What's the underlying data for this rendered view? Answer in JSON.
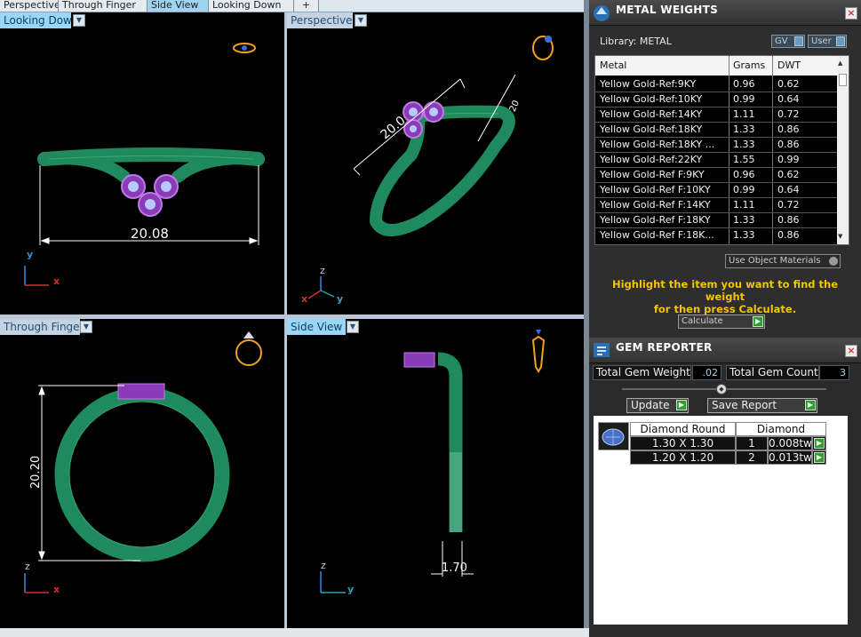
{
  "tabs": [
    {
      "label": "Perspective"
    },
    {
      "label": "Through Finger"
    },
    {
      "label": "Side View",
      "active": true
    },
    {
      "label": "Looking Down"
    },
    {
      "label": "+"
    }
  ],
  "viewports": {
    "top_left": {
      "label": "Looking Down",
      "dimension": "20.08",
      "axes": [
        "y",
        "x"
      ]
    },
    "top_right": {
      "label": "Perspective",
      "dimension_diag": "20.0",
      "dimension_side": "20",
      "axes": [
        "z",
        "x",
        "y"
      ]
    },
    "bottom_left": {
      "label": "Through Finger",
      "dimension": "20.20",
      "axes": [
        "z",
        "x"
      ]
    },
    "bottom_right": {
      "label": "Side View",
      "dimension": "1.70",
      "axes": [
        "z",
        "y"
      ]
    }
  },
  "metal_weights": {
    "title": "METAL WEIGHTS",
    "close": "×",
    "library_label": "Library: METAL",
    "toggles": [
      "GV",
      "User"
    ],
    "columns": [
      "Metal",
      "Grams",
      "DWT"
    ],
    "rows": [
      {
        "metal": "Yellow Gold-Ref:9KY",
        "grams": "0.96",
        "dwt": "0.62"
      },
      {
        "metal": "Yellow Gold-Ref:10KY",
        "grams": "0.99",
        "dwt": "0.64"
      },
      {
        "metal": "Yellow Gold-Ref:14KY",
        "grams": "1.11",
        "dwt": "0.72"
      },
      {
        "metal": "Yellow Gold-Ref:18KY",
        "grams": "1.33",
        "dwt": "0.86"
      },
      {
        "metal": "Yellow Gold-Ref:18KY ...",
        "grams": "1.33",
        "dwt": "0.86"
      },
      {
        "metal": "Yellow Gold-Ref:22KY",
        "grams": "1.55",
        "dwt": "0.99"
      },
      {
        "metal": "Yellow Gold-Ref F:9KY",
        "grams": "0.96",
        "dwt": "0.62"
      },
      {
        "metal": "Yellow Gold-Ref F:10KY",
        "grams": "0.99",
        "dwt": "0.64"
      },
      {
        "metal": "Yellow Gold-Ref F:14KY",
        "grams": "1.11",
        "dwt": "0.72"
      },
      {
        "metal": "Yellow Gold-Ref F:18KY",
        "grams": "1.33",
        "dwt": "0.86"
      },
      {
        "metal": "Yellow Gold-Ref F:18K...",
        "grams": "1.33",
        "dwt": "0.86"
      }
    ],
    "use_object_materials": "Use Object Materials",
    "hint_line1": "Highlight the item you want to find the weight",
    "hint_line2": "for then press Calculate.",
    "calculate_label": "Calculate"
  },
  "gem_reporter": {
    "title": "GEM REPORTER",
    "close": "×",
    "total_weight_label": "Total Gem Weight",
    "total_weight_value": ".02",
    "total_count_label": "Total Gem Count",
    "total_count_value": "3",
    "update_label": "Update",
    "save_report_label": "Save Report",
    "group_shape": "Diamond Round",
    "group_material": "Diamond",
    "stones": [
      {
        "size": "1.30 X 1.30",
        "count": "1",
        "weight": "0.008tw"
      },
      {
        "size": "1.20 X 1.20",
        "count": "2",
        "weight": "0.013tw"
      }
    ]
  },
  "colors": {
    "metal_green": "#1f8a5e",
    "gem_purple": "#8a3bb8",
    "dimension_white": "#ffffff",
    "hint_yellow": "#f5c400",
    "viewport_label_blue": "#9ad6f5"
  }
}
